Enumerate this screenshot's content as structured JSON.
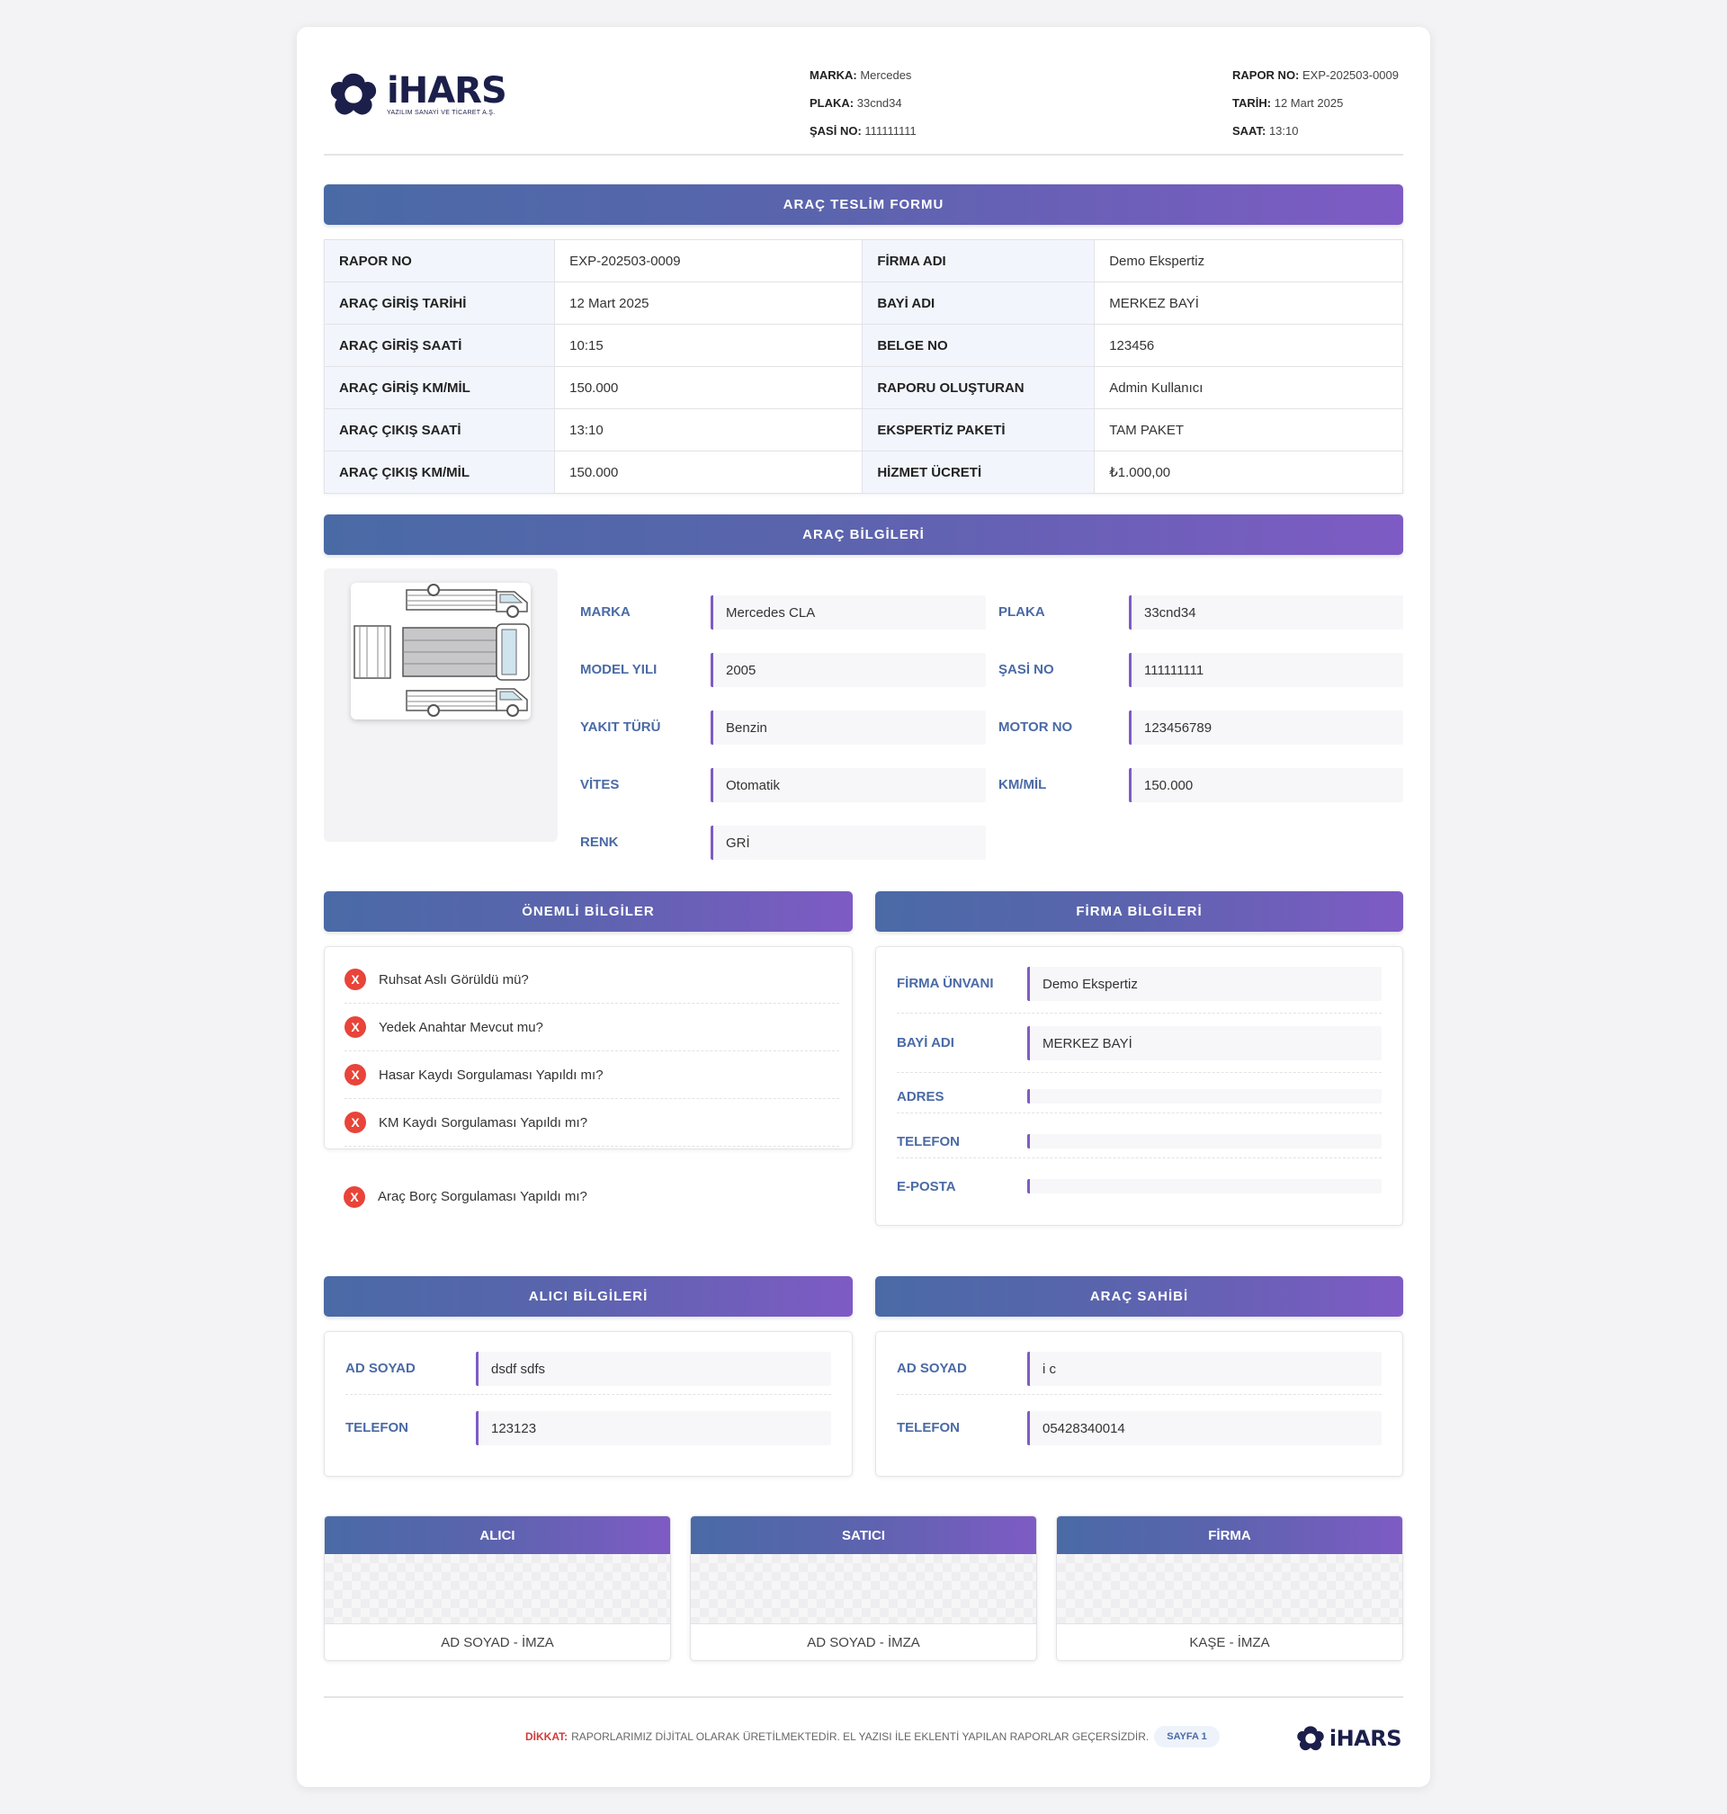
{
  "brand": {
    "name": "iHARS",
    "subtitle": "YAZILIM SANAYİ VE TİCARET A.Ş.",
    "color": "#1b1f4a"
  },
  "header": {
    "marka_label": "MARKA:",
    "marka": "Mercedes",
    "plaka_label": "PLAKA:",
    "plaka": "33cnd34",
    "sasi_label": "ŞASİ NO:",
    "sasi": "111111111",
    "rapor_label": "RAPOR NO:",
    "rapor": "EXP-202503-0009",
    "tarih_label": "TARİH:",
    "tarih": "12 Mart 2025",
    "saat_label": "SAAT:",
    "saat": "13:10"
  },
  "teslim": {
    "title": "ARAÇ TESLİM FORMU",
    "rows": [
      {
        "k1": "RAPOR NO",
        "v1": "EXP-202503-0009",
        "k2": "FİRMA ADI",
        "v2": "Demo Ekspertiz"
      },
      {
        "k1": "ARAÇ GİRİŞ TARİHİ",
        "v1": "12 Mart 2025",
        "k2": "BAYİ ADI",
        "v2": "MERKEZ BAYİ"
      },
      {
        "k1": "ARAÇ GİRİŞ SAATİ",
        "v1": "10:15",
        "k2": "BELGE NO",
        "v2": "123456"
      },
      {
        "k1": "ARAÇ GİRİŞ KM/MİL",
        "v1": "150.000",
        "k2": "RAPORU OLUŞTURAN",
        "v2": "Admin Kullanıcı"
      },
      {
        "k1": "ARAÇ ÇIKIŞ SAATİ",
        "v1": "13:10",
        "k2": "EKSPERTİZ PAKETİ",
        "v2": "TAM PAKET"
      },
      {
        "k1": "ARAÇ ÇIKIŞ KM/MİL",
        "v1": "150.000",
        "k2": "HİZMET ÜCRETİ",
        "v2": "₺1.000,00"
      }
    ]
  },
  "arac": {
    "title": "ARAÇ BİLGİLERİ",
    "left": [
      {
        "label": "MARKA",
        "value": "Mercedes CLA"
      },
      {
        "label": "MODEL YILI",
        "value": "2005"
      },
      {
        "label": "YAKIT TÜRÜ",
        "value": "Benzin"
      },
      {
        "label": "VİTES",
        "value": "Otomatik"
      },
      {
        "label": "RENK",
        "value": "GRİ"
      }
    ],
    "right": [
      {
        "label": "PLAKA",
        "value": "33cnd34"
      },
      {
        "label": "ŞASİ NO",
        "value": "111111111"
      },
      {
        "label": "MOTOR NO",
        "value": "123456789"
      },
      {
        "label": "KM/MİL",
        "value": "150.000"
      }
    ]
  },
  "onemli": {
    "title": "ÖNEMLİ BİLGİLER",
    "mark": "X",
    "items": [
      "Ruhsat Aslı Görüldü mü?",
      "Yedek Anahtar Mevcut mu?",
      "Hasar Kaydı Sorgulaması Yapıldı mı?",
      "KM Kaydı Sorgulaması Yapıldı mı?",
      "Araç Borç Sorgulaması Yapıldı mı?"
    ]
  },
  "firma": {
    "title": "FİRMA BİLGİLERİ",
    "rows": [
      {
        "label": "FİRMA ÜNVANI",
        "value": "Demo Ekspertiz"
      },
      {
        "label": "BAYİ ADI",
        "value": "MERKEZ BAYİ"
      },
      {
        "label": "ADRES",
        "value": ""
      },
      {
        "label": "TELEFON",
        "value": ""
      },
      {
        "label": "E-POSTA",
        "value": ""
      }
    ]
  },
  "alici": {
    "title": "ALICI BİLGİLERİ",
    "rows": [
      {
        "label": "AD SOYAD",
        "value": "dsdf sdfs"
      },
      {
        "label": "TELEFON",
        "value": "123123"
      }
    ]
  },
  "sahip": {
    "title": "ARAÇ SAHİBİ",
    "rows": [
      {
        "label": "AD SOYAD",
        "value": "i c"
      },
      {
        "label": "TELEFON",
        "value": "05428340014"
      }
    ]
  },
  "signatures": [
    {
      "title": "ALICI",
      "footer": "AD SOYAD - İMZA"
    },
    {
      "title": "SATICI",
      "footer": "AD SOYAD - İMZA"
    },
    {
      "title": "FİRMA",
      "footer": "KAŞE - İMZA"
    }
  ],
  "footer": {
    "warn_label": "DİKKAT:",
    "warn_text": "RAPORLARIMIZ DİJİTAL OLARAK ÜRETİLMEKTEDİR. EL YAZISI İLE EKLENTİ YAPILAN RAPORLAR GEÇERSİZDİR.",
    "page": "SAYFA 1"
  },
  "colors": {
    "accent_start": "#4a6aa6",
    "accent_end": "#7e5bc4",
    "error": "#e8443a"
  }
}
